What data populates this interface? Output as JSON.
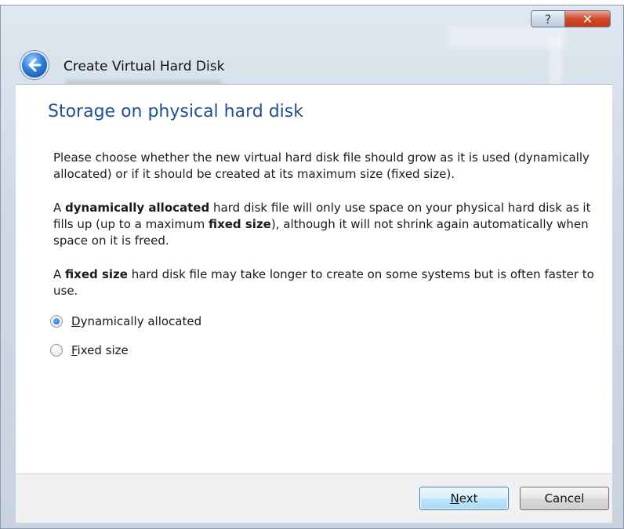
{
  "window": {
    "title": "Create Virtual Hard Disk",
    "help_glyph": "?",
    "close_glyph": "✕",
    "back_icon": "back-arrow-icon"
  },
  "page": {
    "heading": "Storage on physical hard disk",
    "paragraph1": "Please choose whether the new virtual hard disk file should grow as it is used (dynamically allocated) or if it should be created at its maximum size (fixed size).",
    "paragraph2": {
      "part1": "A ",
      "bold1": "dynamically allocated",
      "part2": " hard disk file will only use space on your physical hard disk as it fills up (up to a maximum ",
      "bold2": "fixed size",
      "part3": "), although it will not shrink again automatically when space on it is freed."
    },
    "paragraph3": {
      "part1": "A ",
      "bold1": "fixed size",
      "part2": " hard disk file may take longer to create on some systems but is often faster to use."
    }
  },
  "options": {
    "dynamic": {
      "label": "Dynamically allocated",
      "selected": true
    },
    "fixed": {
      "label": "Fixed size",
      "selected": false
    }
  },
  "buttons": {
    "next": "Next",
    "cancel": "Cancel"
  },
  "colors": {
    "heading": "#1e4f97",
    "close_button": "#d2492a",
    "default_button_border": "#3c7fb1"
  }
}
